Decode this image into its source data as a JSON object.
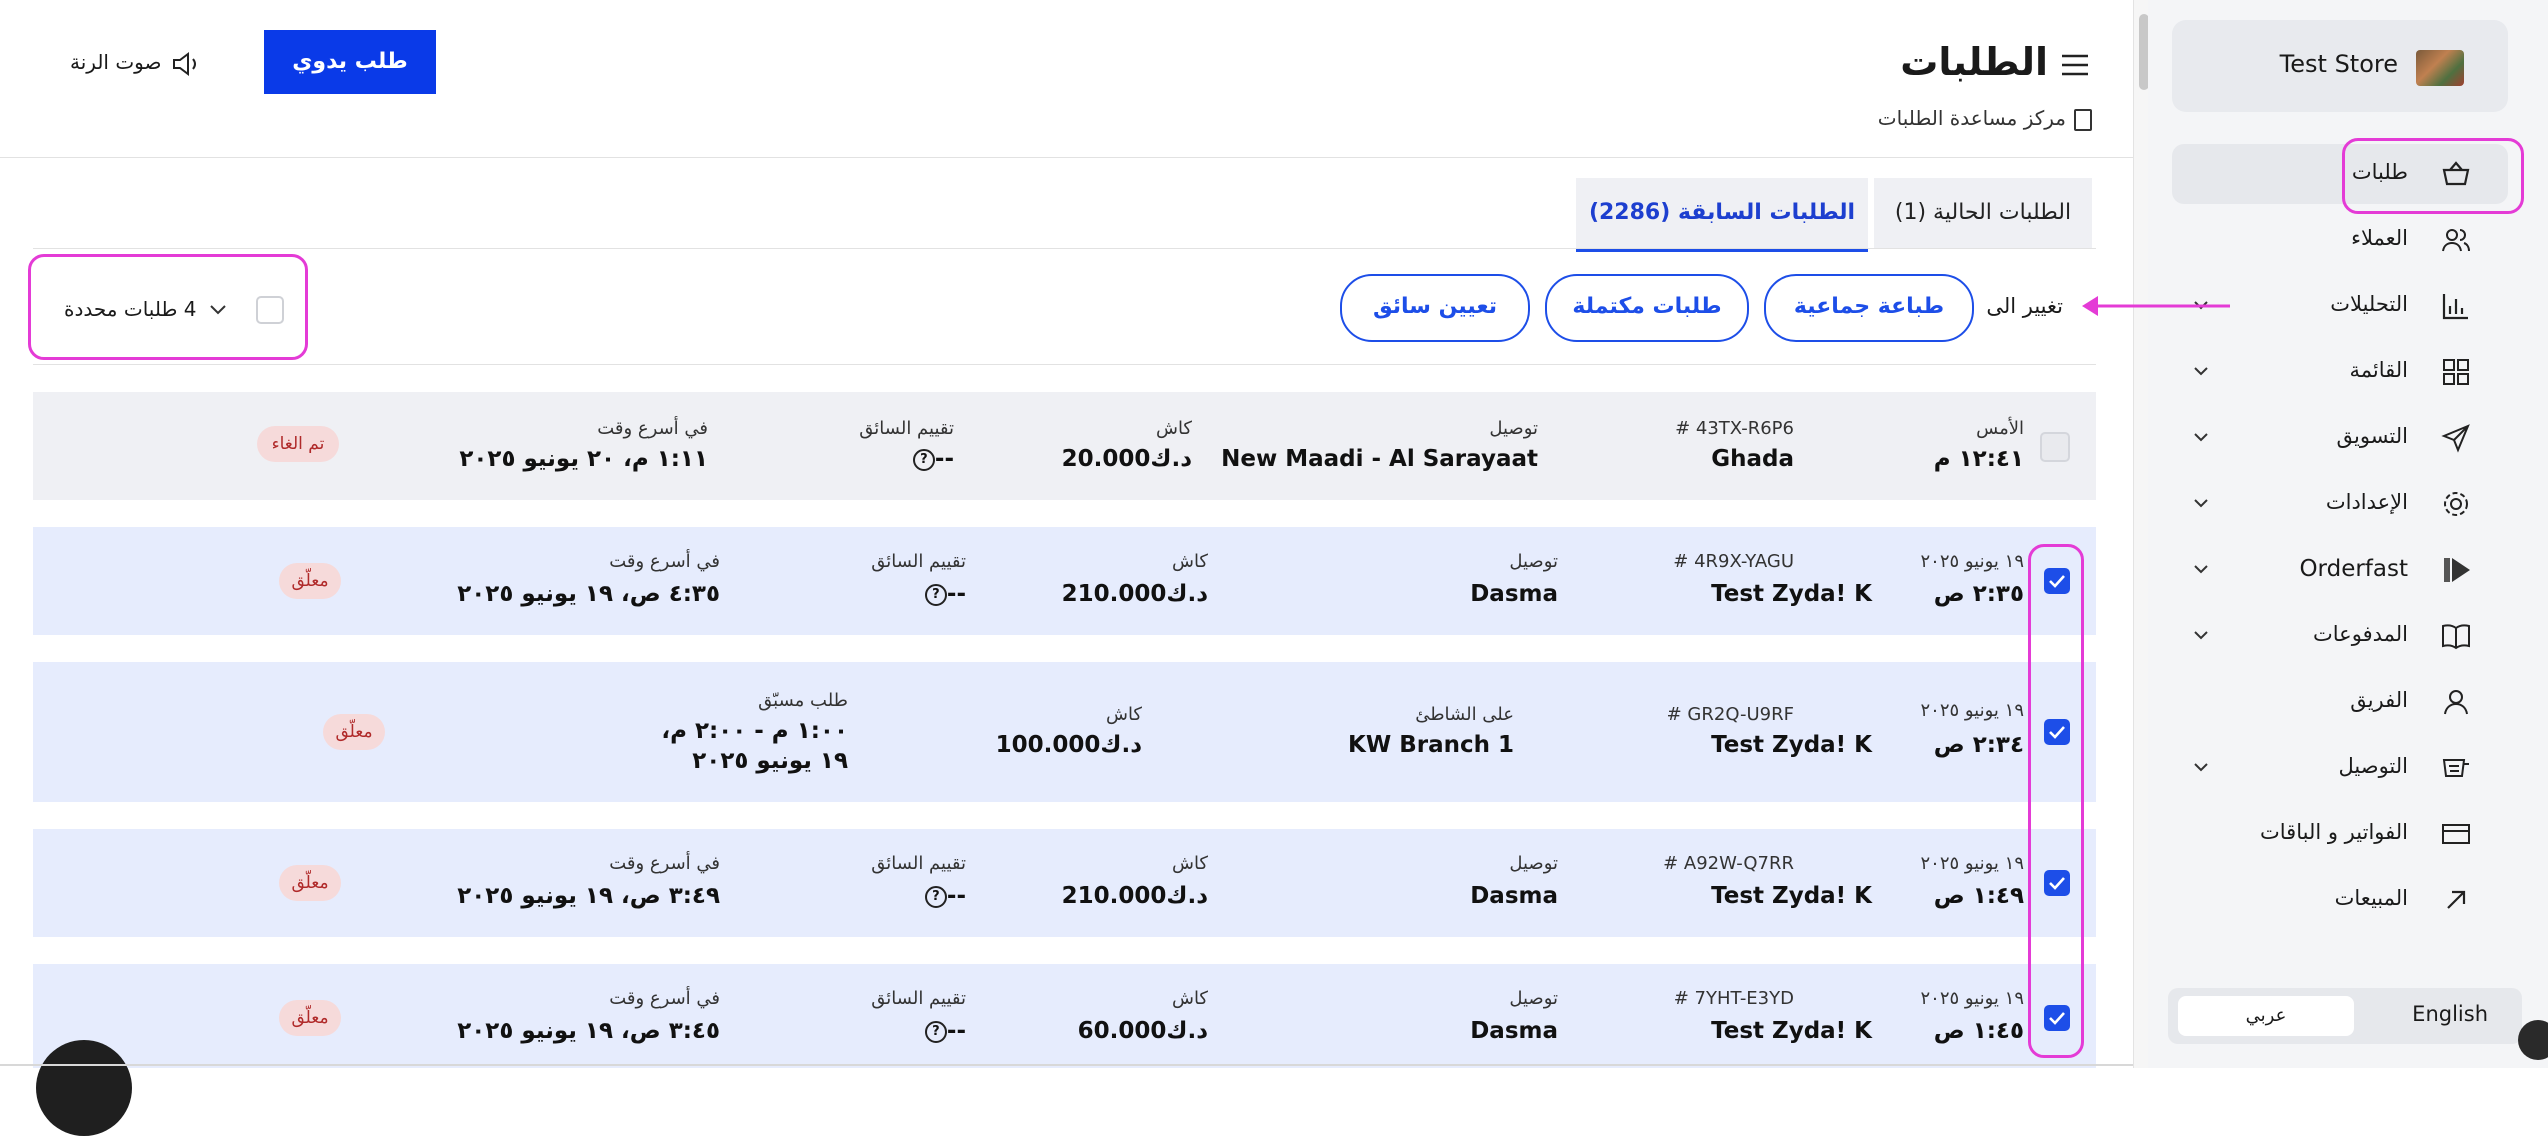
{
  "header": {
    "title": "الطلبات",
    "help_center": "مركز مساعدة الطلبات",
    "manual_order_button": "طلب يدوي",
    "ring_sound": "صوت الرنة"
  },
  "tabs": [
    {
      "label": "الطلبات الحالية (1)",
      "active": false
    },
    {
      "label": "الطلبات السابقة (2286)",
      "active": true
    }
  ],
  "bulk": {
    "change_to": "تغيير الى",
    "actions": [
      "طباعة جماعية",
      "طلبات مكتملة",
      "تعيين سائق"
    ],
    "selected": "4 طلبات محددة"
  },
  "orders": [
    {
      "date": "الأمس",
      "time": "١٢:٤١ م",
      "id": "# 43TX-R6P6",
      "customer": "Ghada",
      "method_label": "توصيل",
      "method_value": "New Maadi - Al Sarayaat",
      "pay_label": "كاش",
      "amount": "20.000د.ك",
      "rating_label": "تقييم السائق",
      "rating": "--",
      "time_label": "في أسرع وقت",
      "time_value": "١:١١ م، ٢٠ يونيو ٢٠٢٥",
      "status": "تم الغاء",
      "checked": false
    },
    {
      "date": "١٩ يونيو ٢٠٢٥",
      "time": "٢:٣٥ ص",
      "id": "# 4R9X-YAGU",
      "customer": "Test Zyda! K",
      "method_label": "توصيل",
      "method_value": "Dasma",
      "pay_label": "كاش",
      "amount": "210.000د.ك",
      "rating_label": "تقييم السائق",
      "rating": "--",
      "time_label": "في أسرع وقت",
      "time_value": "٤:٣٥ ص، ١٩ يونيو ٢٠٢٥",
      "status": "معلّق",
      "checked": true
    },
    {
      "date": "١٩ يونيو ٢٠٢٥",
      "time": "٢:٣٤ ص",
      "id": "# GR2Q-U9RF",
      "customer": "Test Zyda! K",
      "method_label": "على الشاطئ",
      "method_value": "KW Branch 1",
      "pay_label": "كاش",
      "amount": "100.000د.ك",
      "time_label": "طلب مسبّق",
      "time_line1": "١:٠٠ م - ٢:٠٠ م،",
      "time_line2": "١٩ يونيو ٢٠٢٥",
      "status": "معلّق",
      "checked": true
    },
    {
      "date": "١٩ يونيو ٢٠٢٥",
      "time": "١:٤٩ ص",
      "id": "# A92W-Q7RR",
      "customer": "Test Zyda! K",
      "method_label": "توصيل",
      "method_value": "Dasma",
      "pay_label": "كاش",
      "amount": "210.000د.ك",
      "rating_label": "تقييم السائق",
      "rating": "--",
      "time_label": "في أسرع وقت",
      "time_value": "٣:٤٩ ص، ١٩ يونيو ٢٠٢٥",
      "status": "معلّق",
      "checked": true
    },
    {
      "date": "١٩ يونيو ٢٠٢٥",
      "time": "١:٤٥ ص",
      "id": "# 7YHT-E3YD",
      "customer": "Test Zyda! K",
      "method_label": "توصيل",
      "method_value": "Dasma",
      "pay_label": "كاش",
      "amount": "60.000د.ك",
      "rating_label": "تقييم السائق",
      "rating": "--",
      "time_label": "في أسرع وقت",
      "time_value": "٣:٤٥ ص، ١٩ يونيو ٢٠٢٥",
      "status": "معلّق",
      "checked": true
    }
  ],
  "sidebar": {
    "store_name": "Test Store",
    "items": [
      {
        "label": "طلبات",
        "icon": "basket-icon"
      },
      {
        "label": "العملاء",
        "icon": "users-icon"
      },
      {
        "label": "التحليلات",
        "icon": "chart-icon"
      },
      {
        "label": "القائمة",
        "icon": "grid-icon"
      },
      {
        "label": "التسويق",
        "icon": "send-icon"
      },
      {
        "label": "الإعدادات",
        "icon": "gear-icon"
      },
      {
        "label": "Orderfast",
        "icon": "orderfast-icon"
      },
      {
        "label": "المدفوعات",
        "icon": "book-icon"
      },
      {
        "label": "الفريق",
        "icon": "user-icon"
      },
      {
        "label": "التوصيل",
        "icon": "delivery-icon"
      },
      {
        "label": "الفواتير و الباقات",
        "icon": "card-icon"
      },
      {
        "label": "المبيعات",
        "icon": "arrow-icon"
      }
    ],
    "lang_english": "English",
    "lang_arabic": "عربي"
  },
  "colors": {
    "accent": "#0a3ae8",
    "highlight": "#e43bd6",
    "row_selected": "#e6ecfd",
    "row_cancelled": "#eff0f4"
  }
}
